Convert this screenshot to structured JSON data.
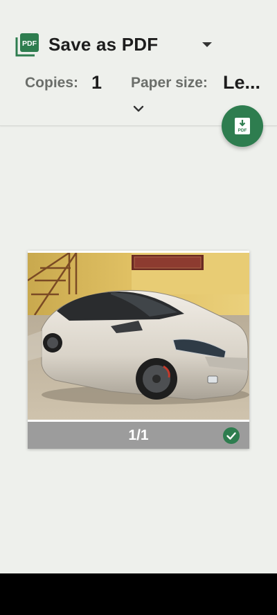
{
  "header": {
    "printer_icon": "pdf-file-icon",
    "printer_icon_text": "PDF",
    "printer_name": "Save as PDF",
    "dropdown_icon": "caret-down-icon",
    "expand_icon": "chevron-down-icon"
  },
  "settings": {
    "copies_label": "Copies:",
    "copies_value": "1",
    "paper_size_label": "Paper size:",
    "paper_size_value": "Le..."
  },
  "fab": {
    "icon": "download-pdf-icon",
    "icon_text": "PDF"
  },
  "preview": {
    "page_number": "1/1",
    "selected_icon": "check-circle-icon"
  },
  "colors": {
    "background": "#eef0ec",
    "accent": "#2e7d4f",
    "footer": "#9c9c9c",
    "nav_bar": "#000000"
  }
}
